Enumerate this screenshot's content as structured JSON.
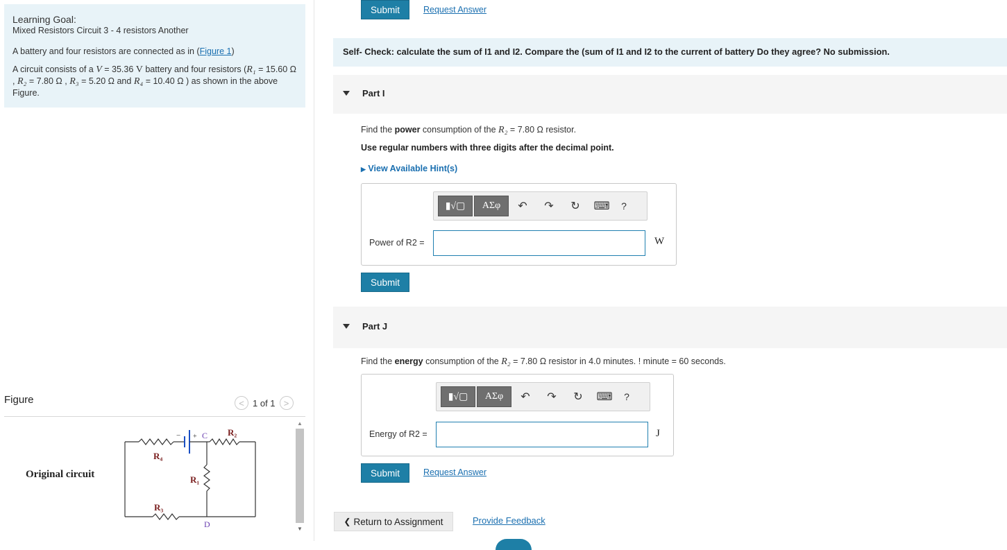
{
  "learning_goal": {
    "title": "Learning Goal:",
    "subtitle": "Mixed Resistors Circuit 3 - 4 resistors Another",
    "intro_text": "A battery and four resistors are connected as in (",
    "figure_link": "Figure 1",
    "intro_close": ")",
    "circuit_pre": "A circuit consists of a ",
    "v_symbol": "V",
    "v_value": " = 35.36 ",
    "v_unit": "V",
    "circuit_mid": " battery and four resistors (",
    "r1": "R₁",
    "r1_val": " = 15.60 Ω , ",
    "r2": "R₂",
    "r2_val": " = 7.80 Ω , ",
    "r3": "R₃",
    "r3_val": " = 5.20 Ω and ",
    "r4": "R₄",
    "r4_val": " = 10.40 Ω ) as shown in the  above Figure."
  },
  "figure": {
    "header": "Figure",
    "pager": "1 of 1",
    "prev": "<",
    "next": ">",
    "caption": "Original circuit",
    "labels": {
      "r4": "R₄",
      "r3": "R₃",
      "r1": "R₁",
      "r2": "R₂",
      "c": "C",
      "d": "D",
      "plus": "+",
      "minus": "−"
    }
  },
  "top_actions": {
    "submit": "Submit",
    "request_answer": "Request Answer"
  },
  "self_check": "Self- Check: calculate the sum of I1 and I2. Compare the (sum of I1 and I2 to the current of battery  Do they agree? No submission.",
  "part_i": {
    "label": "Part I",
    "question_pre": "Find the ",
    "question_bold": "power",
    "question_mid": " consumption of the ",
    "question_var": "R₂",
    "question_post": " = 7.80 Ω resistor.",
    "instruction": "Use regular numbers with three digits after the decimal point.",
    "hints": "View Available Hint(s)",
    "answer_label": "Power of R2 =",
    "unit": "W",
    "submit": "Submit"
  },
  "part_j": {
    "label": "Part J",
    "question_pre": "Find the ",
    "question_bold": "energy",
    "question_mid": " consumption of the ",
    "question_var": "R₂",
    "question_post": " = 7.80 Ω resistor in 4.0 minutes. ! minute = 60 seconds.",
    "answer_label": "Energy of R2 =",
    "unit": "J",
    "submit": "Submit",
    "request_answer": "Request Answer"
  },
  "toolbar": {
    "template_btn": "▮√▢",
    "greek_btn": "ΑΣφ",
    "undo": "↶",
    "redo": "↷",
    "reset": "↻",
    "keyboard": "⌨",
    "help": "?"
  },
  "footer": {
    "return": "Return to Assignment",
    "return_icon": "❮",
    "feedback": "Provide Feedback"
  }
}
